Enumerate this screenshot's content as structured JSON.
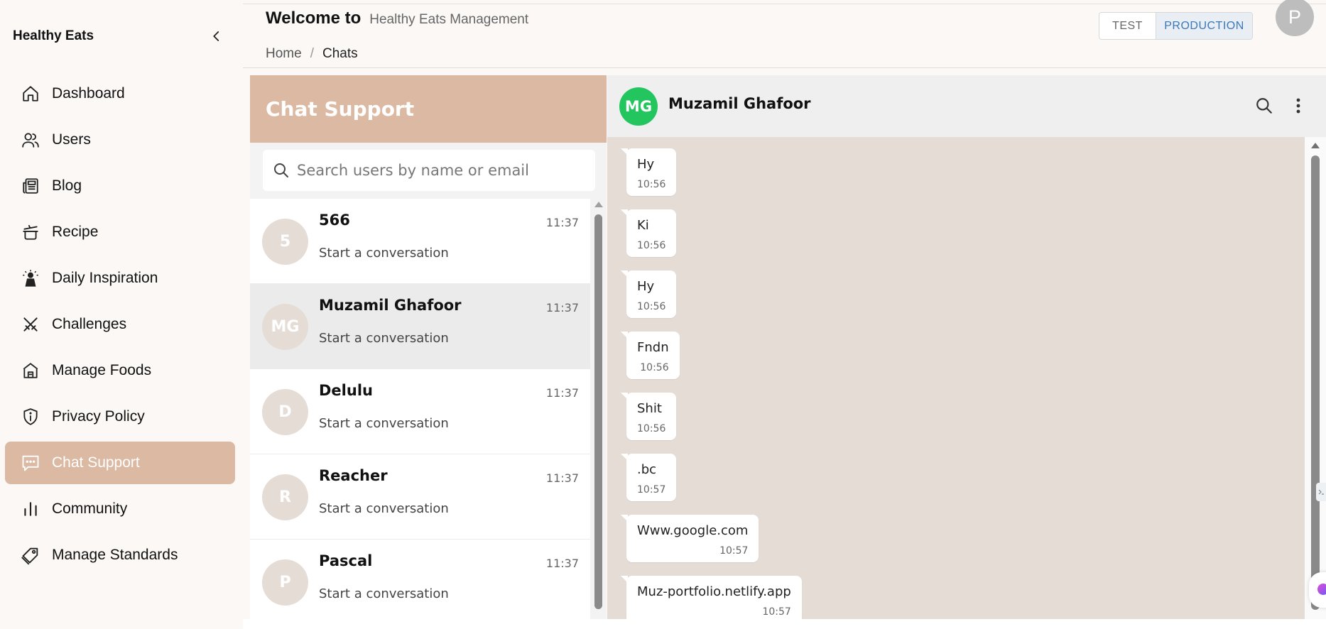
{
  "sidebar": {
    "brand": "Healthy Eats",
    "items": [
      {
        "label": "Dashboard",
        "icon": "home-icon"
      },
      {
        "label": "Users",
        "icon": "users-icon"
      },
      {
        "label": "Blog",
        "icon": "newspaper-icon"
      },
      {
        "label": "Recipe",
        "icon": "cooking-pot-icon"
      },
      {
        "label": "Daily Inspiration",
        "icon": "person-radiance-icon"
      },
      {
        "label": "Challenges",
        "icon": "crossed-swords-icon"
      },
      {
        "label": "Manage Foods",
        "icon": "storefront-icon"
      },
      {
        "label": "Privacy Policy",
        "icon": "shield-info-icon"
      },
      {
        "label": "Chat Support",
        "icon": "chat-bubble-icon",
        "active": true
      },
      {
        "label": "Community",
        "icon": "bar-chart-icon"
      },
      {
        "label": "Manage Standards",
        "icon": "tag-icon"
      }
    ]
  },
  "header": {
    "welcome_title": "Welcome to",
    "welcome_subtitle": "Healthy Eats Management",
    "breadcrumb": [
      "Home",
      "Chats"
    ],
    "breadcrumb_separator": "/",
    "env": {
      "test_label": "TEST",
      "prod_label": "PRODUCTION",
      "selected": "PRODUCTION"
    },
    "user_initial": "P"
  },
  "chat_list": {
    "title": "Chat Support",
    "search_placeholder": "Search users by name or email",
    "conversations": [
      {
        "initials": "5",
        "name": "566",
        "time": "11:37",
        "preview": "Start a conversation"
      },
      {
        "initials": "MG",
        "name": "Muzamil Ghafoor",
        "time": "11:37",
        "preview": "Start a conversation",
        "selected": true
      },
      {
        "initials": "D",
        "name": "Delulu",
        "time": "11:37",
        "preview": "Start a conversation"
      },
      {
        "initials": "R",
        "name": "Reacher",
        "time": "11:37",
        "preview": "Start a conversation"
      },
      {
        "initials": "P",
        "name": "Pascal",
        "time": "11:37",
        "preview": "Start a conversation"
      }
    ]
  },
  "conversation": {
    "initials": "MG",
    "name": "Muzamil Ghafoor",
    "messages": [
      {
        "text": "Hy",
        "time": "10:56"
      },
      {
        "text": "Ki",
        "time": "10:56"
      },
      {
        "text": "Hy",
        "time": "10:56"
      },
      {
        "text": "Fndn",
        "time": "10:56"
      },
      {
        "text": "Shit",
        "time": "10:56"
      },
      {
        "text": ".bc",
        "time": "10:57"
      },
      {
        "text": "Www.google.com",
        "time": "10:57"
      },
      {
        "text": "Muz-portfolio.netlify.app",
        "time": "10:57"
      }
    ]
  },
  "colors": {
    "accent": "#dcb9a3",
    "avatar_green": "#22c55e",
    "chat_background": "#e5dcd5",
    "prod_blue": "#3a78b8"
  }
}
